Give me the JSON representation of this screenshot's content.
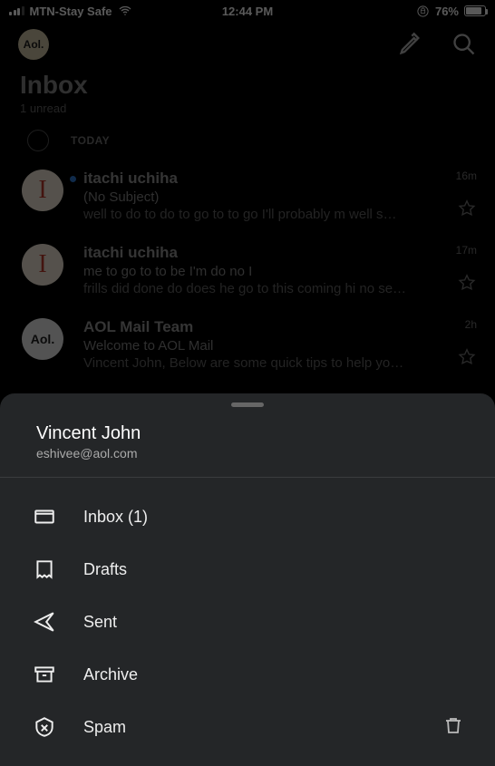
{
  "status": {
    "carrier": "MTN-Stay Safe",
    "time": "12:44 PM",
    "battery_pct": "76%"
  },
  "toolbar": {
    "avatar_text": "Aol."
  },
  "inbox_header": {
    "title": "Inbox",
    "unread_text": "1 unread"
  },
  "today_label": "TODAY",
  "emails": [
    {
      "sender": "itachi uchiha",
      "subject": "(No Subject)",
      "preview": "well to do to do to go to to go I'll probably m well s…",
      "time": "16m",
      "avatar_text": "I",
      "unread": true
    },
    {
      "sender": "itachi uchiha",
      "subject": "me to go to to be I'm do no I",
      "preview": "frills did done do does he go to this coming hi no se…",
      "time": "17m",
      "avatar_text": "I",
      "unread": false
    },
    {
      "sender": "AOL Mail Team",
      "subject": "Welcome to AOL Mail",
      "preview": "Vincent John, Below are some quick tips to help yo…",
      "time": "2h",
      "avatar_text": "Aol.",
      "unread": false
    }
  ],
  "sheet": {
    "account_name": "Vincent John",
    "account_email": "eshivee@aol.com",
    "folders": [
      {
        "label": "Inbox (1)"
      },
      {
        "label": "Drafts"
      },
      {
        "label": "Sent"
      },
      {
        "label": "Archive"
      },
      {
        "label": "Spam"
      }
    ]
  }
}
